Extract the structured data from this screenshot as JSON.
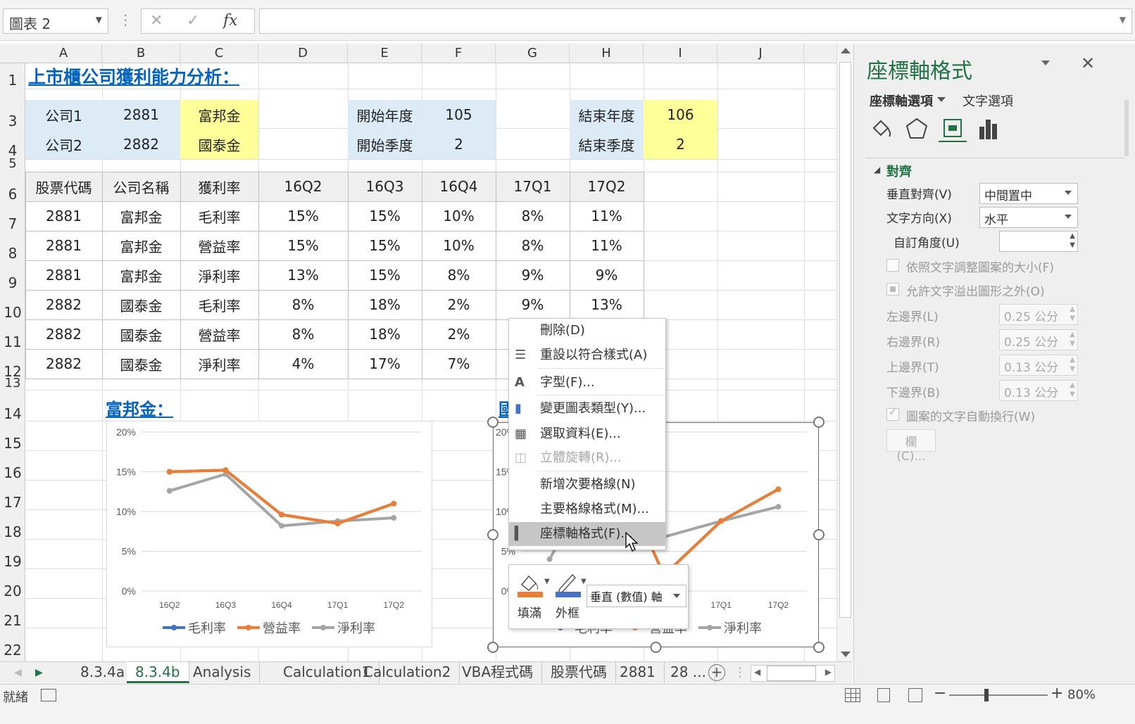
{
  "formula_bar": {
    "name_box": "圖表 2",
    "cancel": "✕",
    "enter": "✓",
    "fx": "fx",
    "formula": ""
  },
  "columns": [
    "A",
    "B",
    "C",
    "D",
    "E",
    "F",
    "G",
    "H",
    "I",
    "J"
  ],
  "rows": [
    "1",
    "2",
    "3",
    "4",
    "5",
    "6",
    "7",
    "8",
    "9",
    "10",
    "11",
    "12",
    "13",
    "14",
    "15",
    "16",
    "17",
    "18",
    "19",
    "20",
    "21",
    "22"
  ],
  "sheet": {
    "title": "上市櫃公司獲利能力分析：",
    "params": {
      "company1_label": "公司1",
      "company1_code": "2881",
      "company1_name": "富邦金",
      "company2_label": "公司2",
      "company2_code": "2882",
      "company2_name": "國泰金",
      "start_year_label": "開始年度",
      "start_year": "105",
      "start_q_label": "開始季度",
      "start_q": "2",
      "end_year_label": "結束年度",
      "end_year": "106",
      "end_q_label": "結束季度",
      "end_q": "2"
    },
    "table_headers": [
      "股票代碼",
      "公司名稱",
      "獲利率",
      "16Q2",
      "16Q3",
      "16Q4",
      "17Q1",
      "17Q2"
    ],
    "table_rows": [
      [
        "2881",
        "富邦金",
        "毛利率",
        "15%",
        "15%",
        "10%",
        "8%",
        "11%"
      ],
      [
        "2881",
        "富邦金",
        "營益率",
        "15%",
        "15%",
        "10%",
        "8%",
        "11%"
      ],
      [
        "2881",
        "富邦金",
        "淨利率",
        "13%",
        "15%",
        "8%",
        "9%",
        "9%"
      ],
      [
        "2882",
        "國泰金",
        "毛利率",
        "8%",
        "18%",
        "2%",
        "9%",
        "13%"
      ],
      [
        "2882",
        "國泰金",
        "營益率",
        "8%",
        "18%",
        "2%",
        "",
        ""
      ],
      [
        "2882",
        "國泰金",
        "淨利率",
        "4%",
        "17%",
        "7%",
        "",
        ""
      ]
    ],
    "chart1_title": "富邦金：",
    "chart2_title": "國"
  },
  "chart_data": [
    {
      "type": "line",
      "title": "富邦金：",
      "categories": [
        "16Q2",
        "16Q3",
        "16Q4",
        "17Q1",
        "17Q2"
      ],
      "ylim": [
        0,
        20
      ],
      "yticks": [
        "0%",
        "5%",
        "10%",
        "15%",
        "20%"
      ],
      "legend": "bottom",
      "series": [
        {
          "name": "毛利率",
          "color": "#4472C4",
          "values": [
            15,
            15.2,
            9.6,
            8.5,
            11
          ]
        },
        {
          "name": "營益率",
          "color": "#ED7D31",
          "values": [
            15,
            15.2,
            9.6,
            8.5,
            11
          ]
        },
        {
          "name": "淨利率",
          "color": "#A5A5A5",
          "values": [
            12.6,
            14.7,
            8.2,
            8.8,
            9.2
          ]
        }
      ]
    },
    {
      "type": "line",
      "title": "國",
      "categories": [
        "16Q2",
        "16Q3",
        "16Q4",
        "17Q1",
        "17Q2"
      ],
      "ylim": [
        0,
        20
      ],
      "yticks": [
        "0%",
        "5%",
        "10%",
        "15%",
        "20%"
      ],
      "legend": "bottom",
      "series": [
        {
          "name": "毛利率",
          "color": "#4472C4",
          "values": [
            8,
            18,
            2,
            8.8,
            12.8
          ]
        },
        {
          "name": "營益率",
          "color": "#ED7D31",
          "values": [
            8,
            18,
            2,
            8.8,
            12.8
          ]
        },
        {
          "name": "淨利率",
          "color": "#A5A5A5",
          "values": [
            4,
            17,
            6.8,
            8.8,
            10.6
          ]
        }
      ]
    }
  ],
  "context_menu": [
    {
      "label": "刪除(D)",
      "disabled": false
    },
    {
      "label": "重設以符合樣式(A)",
      "disabled": false
    },
    {
      "label": "字型(F)...",
      "disabled": false
    },
    {
      "label": "變更圖表類型(Y)...",
      "disabled": false
    },
    {
      "label": "選取資料(E)...",
      "disabled": false
    },
    {
      "label": "立體旋轉(R)...",
      "disabled": true
    },
    {
      "label": "新增次要格線(N)",
      "disabled": false
    },
    {
      "label": "主要格線格式(M)...",
      "disabled": false
    },
    {
      "label": "座標軸格式(F)...",
      "disabled": false
    }
  ],
  "mini_toolbar": {
    "fill": "填滿",
    "outline": "外框",
    "element": "垂直 (數值) 軸"
  },
  "tabs": [
    "8.3.4a",
    "8.3.4b",
    "Analysis",
    "Calculation1",
    "Calculation2",
    "VBA程式碼",
    "股票代碼",
    "2881",
    "28 ..."
  ],
  "status": {
    "ready": "就緒",
    "zoom": "80%"
  },
  "pane": {
    "title": "座標軸格式",
    "tab1": "座標軸選項",
    "tab2": "文字選項",
    "section": "對齊",
    "v_align_label": "垂直對齊(V)",
    "v_align": "中間置中",
    "text_dir_label": "文字方向(X)",
    "text_dir": "水平",
    "custom_angle_label": "自訂角度(U)",
    "custom_angle": "",
    "resize_label": "依照文字調整圖案的大小(F)",
    "overflow_label": "允許文字溢出圖形之外(O)",
    "left_margin_label": "左邊界(L)",
    "left_margin": "0.25 公分",
    "right_margin_label": "右邊界(R)",
    "right_margin": "0.25 公分",
    "top_margin_label": "上邊界(T)",
    "top_margin": "0.13 公分",
    "bottom_margin_label": "下邊界(B)",
    "bottom_margin": "0.13 公分",
    "wrap_label": "圖案的文字自動換行(W)",
    "columns_btn": "欄(C)..."
  },
  "colors": {
    "accent": "#217346",
    "link": "#0563C1",
    "header_fill": "#DDEBF7",
    "yellow_fill": "#FFFF99",
    "table_head_fill": "#EFEFEF"
  }
}
